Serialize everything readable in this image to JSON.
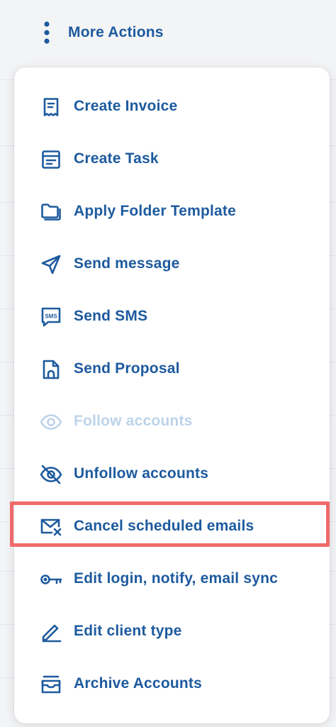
{
  "header": {
    "more_actions_label": "More Actions"
  },
  "colors": {
    "accent": "#1d5a9e",
    "disabled": "#bcd3ea",
    "highlight": "#ef6a6a"
  },
  "menu": {
    "items": [
      {
        "label": "Create Invoice",
        "icon": "invoice-icon",
        "enabled": true
      },
      {
        "label": "Create Task",
        "icon": "task-icon",
        "enabled": true
      },
      {
        "label": "Apply Folder Template",
        "icon": "folder-icon",
        "enabled": true
      },
      {
        "label": "Send message",
        "icon": "paper-plane-icon",
        "enabled": true
      },
      {
        "label": "Send SMS",
        "icon": "sms-icon",
        "enabled": true
      },
      {
        "label": "Send Proposal",
        "icon": "proposal-icon",
        "enabled": true
      },
      {
        "label": "Follow accounts",
        "icon": "eye-icon",
        "enabled": false
      },
      {
        "label": "Unfollow accounts",
        "icon": "eye-off-icon",
        "enabled": true
      },
      {
        "label": "Cancel scheduled emails",
        "icon": "mail-cancel-icon",
        "enabled": true,
        "highlighted": true
      },
      {
        "label": "Edit login, notify, email sync",
        "icon": "key-icon",
        "enabled": true
      },
      {
        "label": "Edit client type",
        "icon": "pencil-icon",
        "enabled": true
      },
      {
        "label": "Archive Accounts",
        "icon": "archive-icon",
        "enabled": true
      }
    ]
  }
}
